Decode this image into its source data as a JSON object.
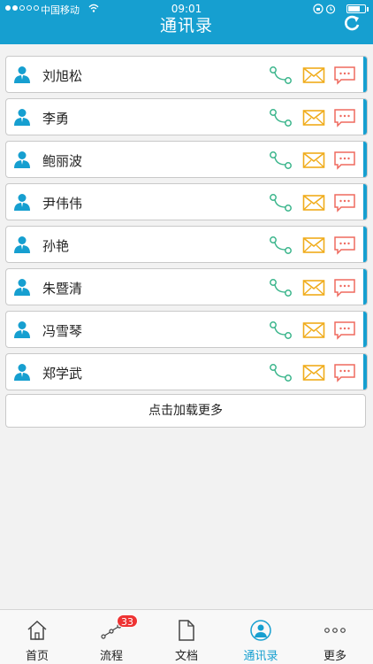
{
  "status_bar": {
    "carrier": "中国移动",
    "time": "09:01"
  },
  "nav": {
    "title": "通讯录"
  },
  "contacts": [
    {
      "name": "刘旭松"
    },
    {
      "name": "李勇"
    },
    {
      "name": "鲍丽波"
    },
    {
      "name": "尹伟伟"
    },
    {
      "name": "孙艳"
    },
    {
      "name": "朱暨清"
    },
    {
      "name": "冯雪琴"
    },
    {
      "name": "郑学武"
    }
  ],
  "load_more_label": "点击加载更多",
  "tabs": [
    {
      "label": "首页",
      "icon": "home-icon"
    },
    {
      "label": "流程",
      "icon": "flow-icon",
      "badge": "33"
    },
    {
      "label": "文档",
      "icon": "document-icon"
    },
    {
      "label": "通讯录",
      "icon": "contacts-icon",
      "active": true
    },
    {
      "label": "更多",
      "icon": "more-icon"
    }
  ],
  "colors": {
    "accent": "#169fd0",
    "phone": "#3ab58b",
    "mail": "#f0ac1b",
    "chat": "#ef6a5f",
    "badge": "#ee3333"
  }
}
